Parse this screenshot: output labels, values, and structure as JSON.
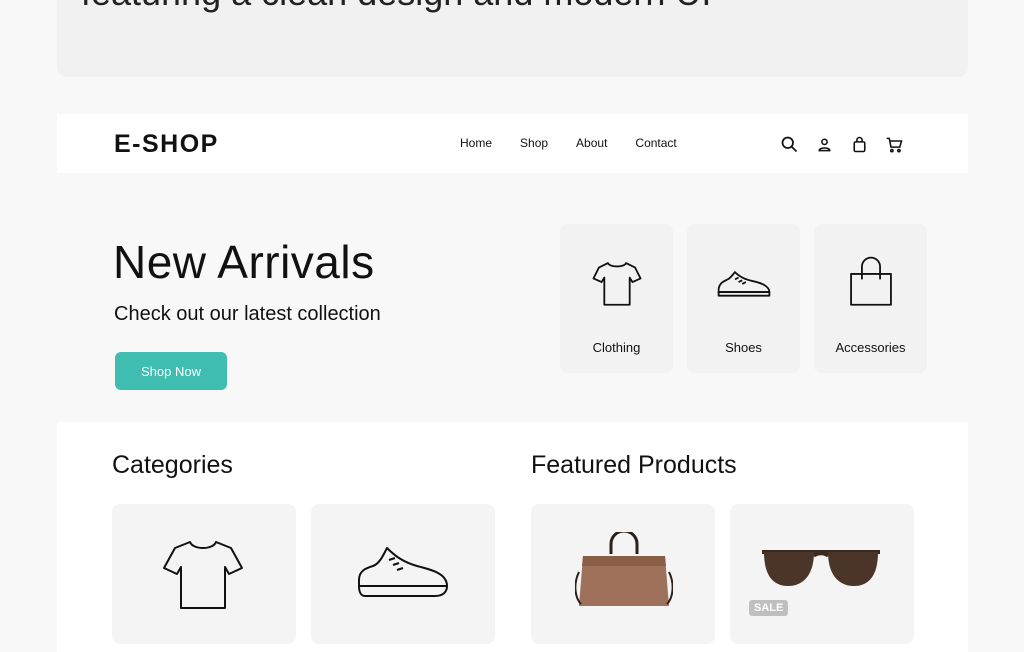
{
  "banner": {
    "partial_text": "featuring a clean design and modern UI"
  },
  "nav": {
    "logo": "E-SHOP",
    "links": [
      "Home",
      "Shop",
      "About",
      "Contact"
    ],
    "icons": [
      "search-icon",
      "user-icon",
      "bag-icon",
      "cart-icon"
    ]
  },
  "hero": {
    "title": "New Arrivals",
    "subtitle": "Check out our latest collection",
    "cta": "Shop Now",
    "cards": [
      {
        "label": "Clothing",
        "icon": "tshirt-icon"
      },
      {
        "label": "Shoes",
        "icon": "shoe-icon"
      },
      {
        "label": "Accessories",
        "icon": "bag-icon"
      }
    ]
  },
  "categories": {
    "title": "Categories",
    "items": [
      {
        "label": "",
        "icon": "tshirt-icon"
      },
      {
        "label": "",
        "icon": "shoe-icon"
      }
    ]
  },
  "featured": {
    "title": "Featured Products",
    "items": [
      {
        "name": "",
        "image": "brown-handbag"
      },
      {
        "name": "",
        "image": "sunglasses",
        "badge": "SALE"
      }
    ]
  },
  "colors": {
    "accent": "#3fbdb0"
  }
}
